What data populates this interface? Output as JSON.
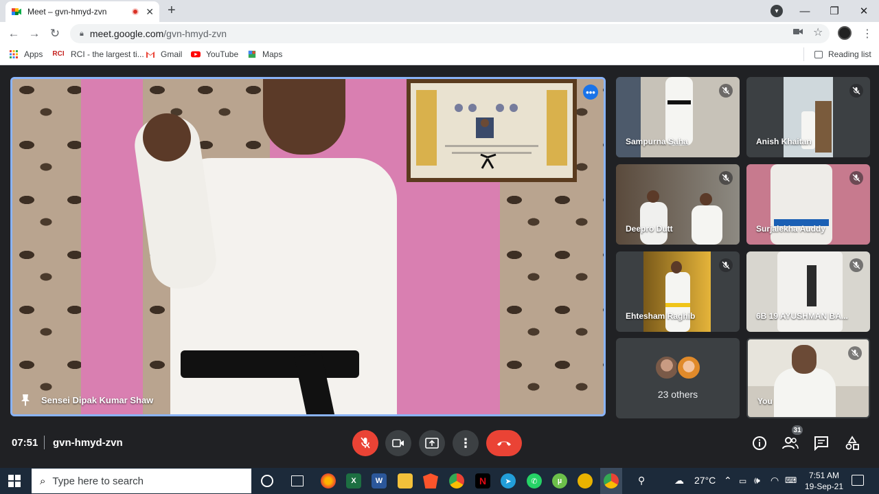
{
  "browser": {
    "tab": {
      "title": "Meet – gvn-hmyd-zvn"
    },
    "url": {
      "host": "meet.google.com",
      "path": "/gvn-hmyd-zvn"
    }
  },
  "bookmarks": {
    "items": [
      {
        "label": "Apps",
        "icon": "apps-grid-icon",
        "color": "#ea4335"
      },
      {
        "label": "RCI - the largest ti...",
        "icon": "RCI",
        "color": "#c5221f"
      },
      {
        "label": "Gmail",
        "icon": "gmail-icon",
        "color": "#ea4335"
      },
      {
        "label": "YouTube",
        "icon": "youtube-icon",
        "color": "#ff0000"
      },
      {
        "label": "Maps",
        "icon": "maps-icon",
        "color": "#34a853"
      }
    ],
    "reading_list": "Reading list"
  },
  "meet": {
    "main_speaker": {
      "name": "Sensei Dipak Kumar Shaw"
    },
    "participants": [
      {
        "name": "Sampurna Saha"
      },
      {
        "name": "Anish Khaitan"
      },
      {
        "name": "Deepro Dutt"
      },
      {
        "name": "Surjalekha Auddy"
      },
      {
        "name": "Ehtesham Raghib"
      },
      {
        "name": "6B 19 AYUSHMAN BA..."
      }
    ],
    "others": {
      "label": "23 others"
    },
    "self": {
      "name": "You"
    },
    "time": "07:51",
    "code": "gvn-hmyd-zvn",
    "participant_count": "31"
  },
  "taskbar": {
    "search_placeholder": "Type here to search",
    "weather": "27°C",
    "time": "7:51 AM",
    "date": "19-Sep-21"
  },
  "colors": {
    "accent_blue": "#8ab4f8",
    "mute_red": "#ea4335",
    "meet_bg": "#202124"
  }
}
